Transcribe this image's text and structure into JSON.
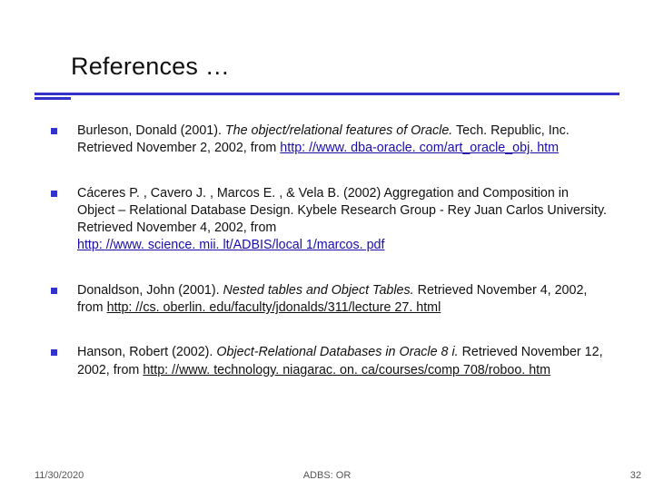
{
  "title": "References …",
  "refs": [
    {
      "pre": "Burleson, Donald (2001). ",
      "italic": "The object/relational features of Oracle.",
      "mid": "  Tech. Republic, Inc. Retrieved November 2, 2002, from  ",
      "link": "http: //www. dba-oracle. com/art_oracle_obj. htm"
    },
    {
      "pre": "Cáceres P. , Cavero J. , Marcos E. , & Vela B. (2002) Aggregation and Composition in Object – Relational Database Design.  Kybele Research Group - Rey Juan Carlos University.  Retrieved November 4, 2002, from ",
      "italic": "",
      "mid": "",
      "link": "http: //www. science. mii. lt/ADBIS/local 1/marcos. pdf"
    },
    {
      "pre": "Donaldson, John (2001). ",
      "italic": "Nested tables and Object Tables.",
      "mid": "  Retrieved November 4, 2002, from ",
      "link": "http: //cs. oberlin. edu/faculty/jdonalds/311/lecture 27. html"
    },
    {
      "pre": "Hanson, Robert (2002). ",
      "italic": "Object-Relational Databases in Oracle 8 i.",
      "mid": "  Retrieved November 12, 2002, from ",
      "link": "http: //www. technology. niagarac. on. ca/courses/comp 708/roboo. htm"
    }
  ],
  "footer": {
    "date": "11/30/2020",
    "center": "ADBS: OR",
    "page": "32"
  }
}
